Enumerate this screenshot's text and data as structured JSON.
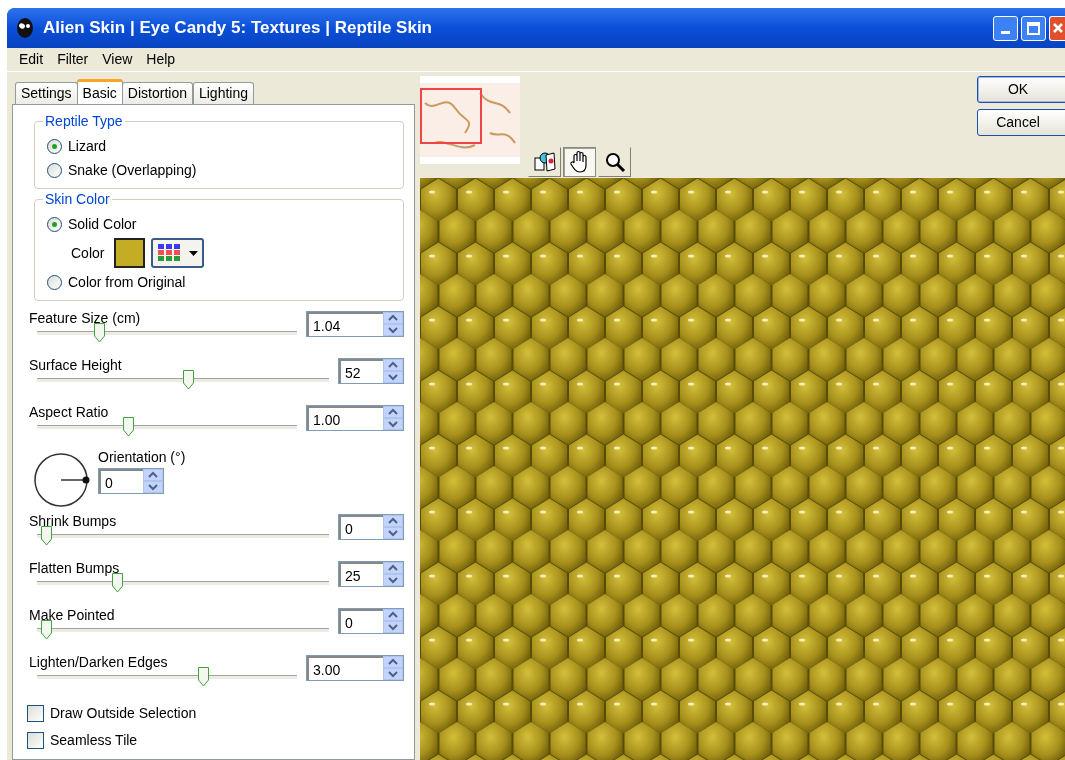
{
  "window": {
    "title": "Alien Skin | Eye Candy 5: Textures | Reptile Skin"
  },
  "menu": [
    "Edit",
    "Filter",
    "View",
    "Help"
  ],
  "tabs": [
    {
      "label": "Settings",
      "selected": false
    },
    {
      "label": "Basic",
      "selected": true
    },
    {
      "label": "Distortion",
      "selected": false
    },
    {
      "label": "Lighting",
      "selected": false
    }
  ],
  "reptile_type": {
    "title": "Reptile Type",
    "options": [
      {
        "label": "Lizard",
        "selected": true
      },
      {
        "label": "Snake (Overlapping)",
        "selected": false
      }
    ]
  },
  "skin_color": {
    "title": "Skin Color",
    "options": [
      {
        "label": "Solid Color",
        "selected": true
      },
      {
        "label": "Color from Original",
        "selected": false
      }
    ],
    "color_label": "Color",
    "color": "#c4ad24"
  },
  "sliders_top": [
    {
      "label": "Feature Size (cm)",
      "value": "1.04",
      "level": 0.22,
      "kind": "decimal"
    },
    {
      "label": "Surface Height",
      "value": "52",
      "level": 0.52,
      "kind": "integer"
    },
    {
      "label": "Aspect Ratio",
      "value": "1.00",
      "level": 0.34,
      "kind": "decimal"
    }
  ],
  "orientation": {
    "label": "Orientation (°)",
    "value": "0"
  },
  "sliders_bottom": [
    {
      "label": "Shrink Bumps",
      "value": "0",
      "level": 0,
      "kind": "integer"
    },
    {
      "label": "Flatten Bumps",
      "value": "25",
      "level": 0.26,
      "kind": "integer"
    },
    {
      "label": "Make Pointed",
      "value": "0",
      "level": 0,
      "kind": "integer"
    },
    {
      "label": "Lighten/Darken Edges",
      "value": "3.00",
      "level": 0.65,
      "kind": "decimal"
    }
  ],
  "checkboxes": [
    {
      "label": "Draw Outside Selection",
      "checked": false
    },
    {
      "label": "Seamless Tile",
      "checked": false
    }
  ],
  "tools": [
    {
      "kind": "compare",
      "selected": false
    },
    {
      "kind": "hand",
      "selected": true
    },
    {
      "kind": "zoom",
      "selected": false
    }
  ],
  "buttons": [
    "OK",
    "Cancel"
  ]
}
